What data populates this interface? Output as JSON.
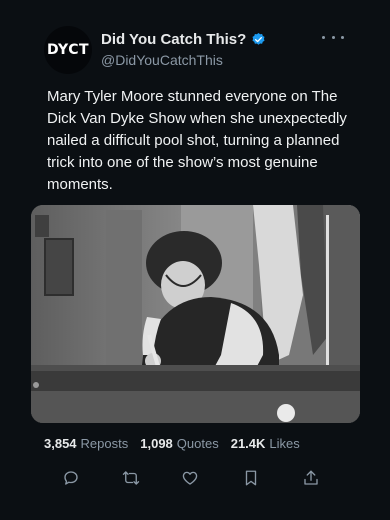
{
  "author": {
    "avatar_text": "DYCT",
    "display_name": "Did You Catch This?",
    "handle": "@DidYouCatchThis",
    "verified_color": "#1d9bf0"
  },
  "tweet": {
    "text": "Mary Tyler Moore stunned everyone on The Dick Van Dyke Show when she unexpectedly nailed a difficult pool shot, turning a planned trick into one of the show’s most genuine moments."
  },
  "media": {
    "kind": "black-and-white photo"
  },
  "stats": {
    "reposts_count": "3,854",
    "reposts_label": "Reposts",
    "quotes_count": "1,098",
    "quotes_label": "Quotes",
    "likes_count": "21.4K",
    "likes_label": "Likes"
  },
  "actions": {
    "icons": [
      "reply-icon",
      "repost-icon",
      "like-icon",
      "bookmark-icon",
      "share-icon"
    ],
    "icon_color": "#8b98a5"
  }
}
